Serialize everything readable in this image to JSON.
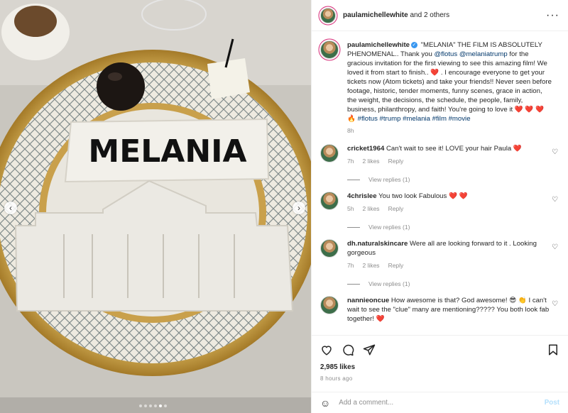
{
  "header": {
    "username": "paulamichellewhite",
    "others": "and 2 others",
    "more_icon": "more-horizontal-icon"
  },
  "media": {
    "cookie_text": "MELANIA",
    "dots_count": 6,
    "active_dot": 4
  },
  "caption": {
    "username": "paulamichellewhite",
    "segments": [
      {
        "t": " \"MELANIA\" THE FILM IS ABSOLUTELY PHENOMENAL.. Thank you ",
        "k": "text"
      },
      {
        "t": "@flotus",
        "k": "link"
      },
      {
        "t": " ",
        "k": "text"
      },
      {
        "t": "@melaniatrump",
        "k": "link"
      },
      {
        "t": " for the gracious invitation for the first viewing to see this amazing film! We loved it from start to finish.. ",
        "k": "text"
      },
      {
        "t": "❤️",
        "k": "heart"
      },
      {
        "t": " . I encourage everyone to get your tickets now (Atom tickets) and take your friends!! Never seen before footage, historic, tender moments, funny scenes, grace in action, the weight, the decisions, the schedule, the people, family, business, philanthropy, and faith! You're going to love it ",
        "k": "text"
      },
      {
        "t": "❤️ ❤️ ❤️ 🔥",
        "k": "heart"
      },
      {
        "t": " ",
        "k": "text"
      },
      {
        "t": "#flotus #trump #melania #film #movie",
        "k": "link"
      }
    ],
    "time": "8h"
  },
  "comments": [
    {
      "username": "cricket1964",
      "text": "Can't wait to see it! LOVE your hair Paula ❤️",
      "time": "7h",
      "likes": "2 likes",
      "reply": "Reply",
      "replies": "View replies (1)"
    },
    {
      "username": "4chrislee",
      "text": "You two look Fabulous ❤️ ❤️",
      "time": "5h",
      "likes": "2 likes",
      "reply": "Reply",
      "replies": "View replies (1)"
    },
    {
      "username": "dh.naturalskincare",
      "text": "Were all are looking forward to it . Looking gorgeous",
      "time": "7h",
      "likes": "2 likes",
      "reply": "Reply",
      "replies": "View replies (1)"
    },
    {
      "username": "nannieoncue",
      "text": "How awesome is that? God awesome! 😎 👏 I can't wait to see the \"clue\" many are mentioning????? You both look fab together! ❤️",
      "time": "",
      "likes": "",
      "reply": "",
      "replies": ""
    }
  ],
  "actions": {
    "likes": "2,985 likes",
    "time_ago": "8 hours ago"
  },
  "add_comment": {
    "placeholder": "Add a comment...",
    "post_label": "Post"
  }
}
